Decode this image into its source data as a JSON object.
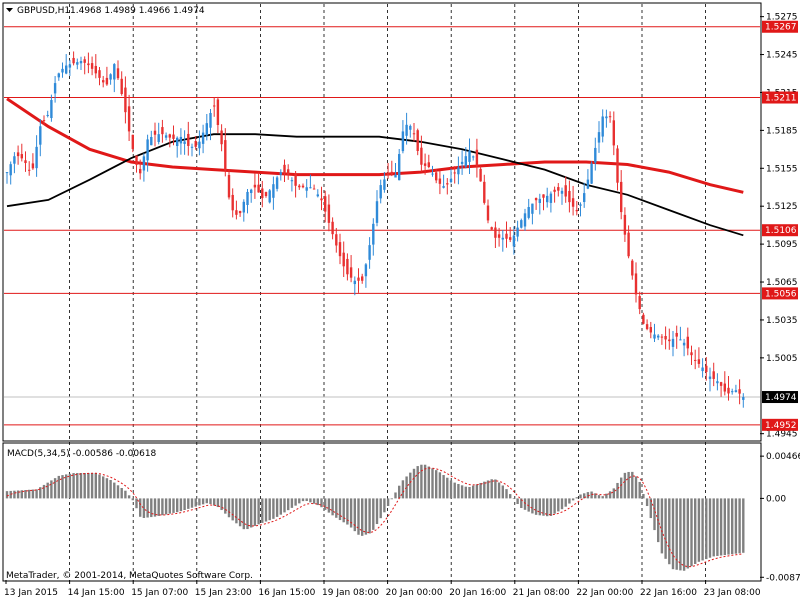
{
  "header": {
    "symbol_tf": "GBPUSD,H1",
    "ohlc": "1.4968 1.4989 1.4966 1.4974"
  },
  "footer": {
    "copyright": "MetaTrader, © 2001-2014, MetaQuotes Software Corp."
  },
  "colors": {
    "background": "#ffffff",
    "grid": "#000000",
    "bull_candle": "#2f8ad8",
    "bear_candle": "#e83030",
    "ma_red": "#e01818",
    "ma_black": "#000000",
    "level_line": "#e01818",
    "macd_hist": "#808080",
    "macd_signal": "#e01818"
  },
  "chart_data": [
    {
      "type": "candlestick",
      "title": "GBPUSD,H1",
      "ylim": [
        1.494,
        1.5285
      ],
      "y_ticks": [
        "1.5275",
        "1.5245",
        "1.5215",
        "1.5185",
        "1.5155",
        "1.5125",
        "1.5095",
        "1.5065",
        "1.5035",
        "1.5005",
        "1.4945"
      ],
      "x_ticks": [
        "13 Jan 2015",
        "14 Jan 15:00",
        "15 Jan 07:00",
        "15 Jan 23:00",
        "16 Jan 15:00",
        "19 Jan 08:00",
        "20 Jan 00:00",
        "20 Jan 16:00",
        "21 Jan 08:00",
        "22 Jan 00:00",
        "22 Jan 16:00",
        "23 Jan 08:00"
      ],
      "levels": [
        {
          "label": "1.5267",
          "value": 1.5267
        },
        {
          "label": "1.5211",
          "value": 1.5211
        },
        {
          "label": "1.5106",
          "value": 1.5106
        },
        {
          "label": "1.5056",
          "value": 1.5056
        },
        {
          "label": "1.4952",
          "value": 1.4952
        }
      ],
      "current_price": {
        "label": "1.4974",
        "value": 1.4974
      },
      "close_path": [
        [
          0,
          1.5152
        ],
        [
          4,
          1.5166
        ],
        [
          8,
          1.5162
        ],
        [
          12,
          1.515
        ],
        [
          16,
          1.5188
        ],
        [
          20,
          1.5198
        ],
        [
          24,
          1.5228
        ],
        [
          28,
          1.5236
        ],
        [
          32,
          1.5238
        ],
        [
          36,
          1.524
        ],
        [
          40,
          1.5236
        ],
        [
          44,
          1.5228
        ],
        [
          48,
          1.522
        ],
        [
          52,
          1.5238
        ],
        [
          56,
          1.521
        ],
        [
          60,
          1.5176
        ],
        [
          64,
          1.5148
        ],
        [
          68,
          1.5178
        ],
        [
          72,
          1.5182
        ],
        [
          76,
          1.5182
        ],
        [
          80,
          1.5178
        ],
        [
          84,
          1.518
        ],
        [
          88,
          1.5172
        ],
        [
          92,
          1.5172
        ],
        [
          96,
          1.5188
        ],
        [
          100,
          1.5206
        ],
        [
          104,
          1.5172
        ],
        [
          108,
          1.5124
        ],
        [
          112,
          1.5116
        ],
        [
          116,
          1.5136
        ],
        [
          120,
          1.514
        ],
        [
          124,
          1.513
        ],
        [
          128,
          1.514
        ],
        [
          132,
          1.5152
        ],
        [
          136,
          1.515
        ],
        [
          140,
          1.514
        ],
        [
          144,
          1.514
        ],
        [
          148,
          1.514
        ],
        [
          152,
          1.513
        ],
        [
          156,
          1.511
        ],
        [
          160,
          1.509
        ],
        [
          164,
          1.5072
        ],
        [
          168,
          1.5066
        ],
        [
          172,
          1.5066
        ],
        [
          176,
          1.51
        ],
        [
          180,
          1.514
        ],
        [
          184,
          1.515
        ],
        [
          188,
          1.515
        ],
        [
          192,
          1.519
        ],
        [
          196,
          1.5188
        ],
        [
          200,
          1.5158
        ],
        [
          204,
          1.5156
        ],
        [
          208,
          1.5144
        ],
        [
          212,
          1.514
        ],
        [
          216,
          1.515
        ],
        [
          220,
          1.516
        ],
        [
          224,
          1.517
        ],
        [
          228,
          1.5154
        ],
        [
          232,
          1.5116
        ],
        [
          236,
          1.51
        ],
        [
          240,
          1.51
        ],
        [
          244,
          1.5098
        ],
        [
          248,
          1.5112
        ],
        [
          252,
          1.5124
        ],
        [
          256,
          1.513
        ],
        [
          260,
          1.5132
        ],
        [
          264,
          1.5136
        ],
        [
          268,
          1.5138
        ],
        [
          272,
          1.5128
        ],
        [
          276,
          1.512
        ],
        [
          280,
          1.514
        ],
        [
          284,
          1.5168
        ],
        [
          288,
          1.5196
        ],
        [
          292,
          1.5196
        ],
        [
          296,
          1.513
        ],
        [
          300,
          1.509
        ],
        [
          304,
          1.5056
        ],
        [
          308,
          1.503
        ],
        [
          312,
          1.5024
        ],
        [
          316,
          1.5022
        ],
        [
          320,
          1.5018
        ],
        [
          324,
          1.5022
        ],
        [
          328,
          1.5016
        ],
        [
          332,
          1.5004
        ],
        [
          336,
          1.4998
        ],
        [
          340,
          1.499
        ],
        [
          344,
          1.4986
        ],
        [
          348,
          1.4976
        ],
        [
          352,
          1.498
        ],
        [
          356,
          1.4974
        ]
      ],
      "series": [
        {
          "path": [
            [
              0,
              1.521
            ],
            [
              20,
              1.5188
            ],
            [
              40,
              1.517
            ],
            [
              60,
              1.516
            ],
            [
              80,
              1.5156
            ],
            [
              100,
              1.5154
            ],
            [
              120,
              1.5152
            ],
            [
              140,
              1.515
            ],
            [
              160,
              1.515
            ],
            [
              180,
              1.515
            ],
            [
              200,
              1.5152
            ],
            [
              220,
              1.5156
            ],
            [
              240,
              1.5158
            ],
            [
              260,
              1.516
            ],
            [
              280,
              1.516
            ],
            [
              300,
              1.5158
            ],
            [
              320,
              1.5152
            ],
            [
              340,
              1.5142
            ],
            [
              356,
              1.5136
            ]
          ]
        },
        {
          "path": [
            [
              0,
              1.5125
            ],
            [
              20,
              1.513
            ],
            [
              40,
              1.5146
            ],
            [
              60,
              1.5163
            ],
            [
              80,
              1.5176
            ],
            [
              100,
              1.5182
            ],
            [
              120,
              1.5182
            ],
            [
              140,
              1.518
            ],
            [
              160,
              1.518
            ],
            [
              180,
              1.518
            ],
            [
              200,
              1.5176
            ],
            [
              220,
              1.517
            ],
            [
              240,
              1.5162
            ],
            [
              260,
              1.5154
            ],
            [
              280,
              1.5142
            ],
            [
              300,
              1.5134
            ],
            [
              320,
              1.5122
            ],
            [
              340,
              1.511
            ],
            [
              356,
              1.5102
            ]
          ]
        }
      ]
    },
    {
      "type": "bar",
      "title": "MACD(5,34,5) -0.00586 -0.00618",
      "ylim": [
        -0.009,
        0.006
      ],
      "y_ticks": [
        "0.00466",
        "0.00",
        "-0.0087"
      ],
      "histogram_path": [
        [
          0,
          0.0008
        ],
        [
          16,
          0.001
        ],
        [
          28,
          0.0025
        ],
        [
          36,
          0.0028
        ],
        [
          48,
          0.0028
        ],
        [
          56,
          0.002
        ],
        [
          64,
          0.0008
        ],
        [
          68,
          -0.0003
        ],
        [
          72,
          -0.0022
        ],
        [
          80,
          -0.002
        ],
        [
          92,
          -0.0015
        ],
        [
          100,
          -0.001
        ],
        [
          108,
          -0.0005
        ],
        [
          114,
          -0.001
        ],
        [
          120,
          -0.0022
        ],
        [
          128,
          -0.0035
        ],
        [
          136,
          -0.0028
        ],
        [
          144,
          -0.0022
        ],
        [
          152,
          -0.0012
        ],
        [
          160,
          -0.0002
        ],
        [
          168,
          -0.0008
        ],
        [
          176,
          -0.002
        ],
        [
          184,
          -0.003
        ],
        [
          190,
          -0.0042
        ],
        [
          196,
          -0.0038
        ],
        [
          204,
          -0.0012
        ],
        [
          212,
          0.0018
        ],
        [
          220,
          0.0035
        ],
        [
          224,
          0.0038
        ],
        [
          232,
          0.003
        ],
        [
          240,
          0.0018
        ],
        [
          248,
          0.0012
        ],
        [
          256,
          0.0018
        ],
        [
          262,
          0.0022
        ],
        [
          268,
          0.0012
        ],
        [
          276,
          -0.001
        ],
        [
          284,
          -0.0018
        ],
        [
          292,
          -0.002
        ],
        [
          300,
          -0.001
        ],
        [
          308,
          0.0004
        ],
        [
          314,
          0.0008
        ],
        [
          320,
          0.0002
        ],
        [
          326,
          0.001
        ],
        [
          332,
          0.0028
        ],
        [
          336,
          0.003
        ],
        [
          340,
          0.002
        ],
        [
          346,
          -0.002
        ],
        [
          352,
          -0.006
        ],
        [
          358,
          -0.0078
        ],
        [
          364,
          -0.008
        ],
        [
          372,
          -0.007
        ],
        [
          380,
          -0.0064
        ],
        [
          388,
          -0.0062
        ],
        [
          396,
          -0.006
        ]
      ]
    }
  ]
}
